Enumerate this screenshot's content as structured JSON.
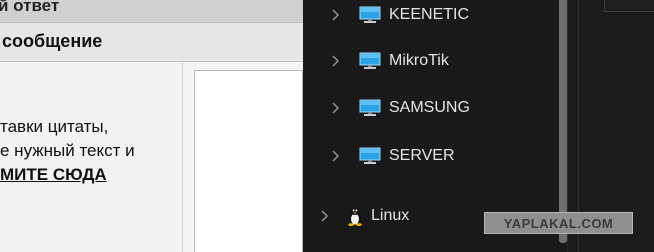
{
  "forum": {
    "header_title": "й ответ",
    "subheader_title": "сообщение",
    "hint_lines": [
      "тавки цитаты,",
      "е нужный текст и"
    ],
    "click_here": "МИТЕ СЮДА"
  },
  "explorer": {
    "items": [
      {
        "label": "KEENETIC",
        "icon": "monitor-icon"
      },
      {
        "label": "MikroTik",
        "icon": "monitor-icon"
      },
      {
        "label": "SAMSUNG",
        "icon": "monitor-icon"
      },
      {
        "label": "SERVER",
        "icon": "monitor-icon"
      }
    ],
    "linux": {
      "label": "Linux",
      "icon": "tux-icon"
    }
  },
  "watermark": {
    "text": "YAPLAKAL.COM"
  },
  "colors": {
    "explorer_bg": "#191919",
    "forum_bg": "#f4f4f4",
    "monitor_blue": "#2aa3e8"
  }
}
